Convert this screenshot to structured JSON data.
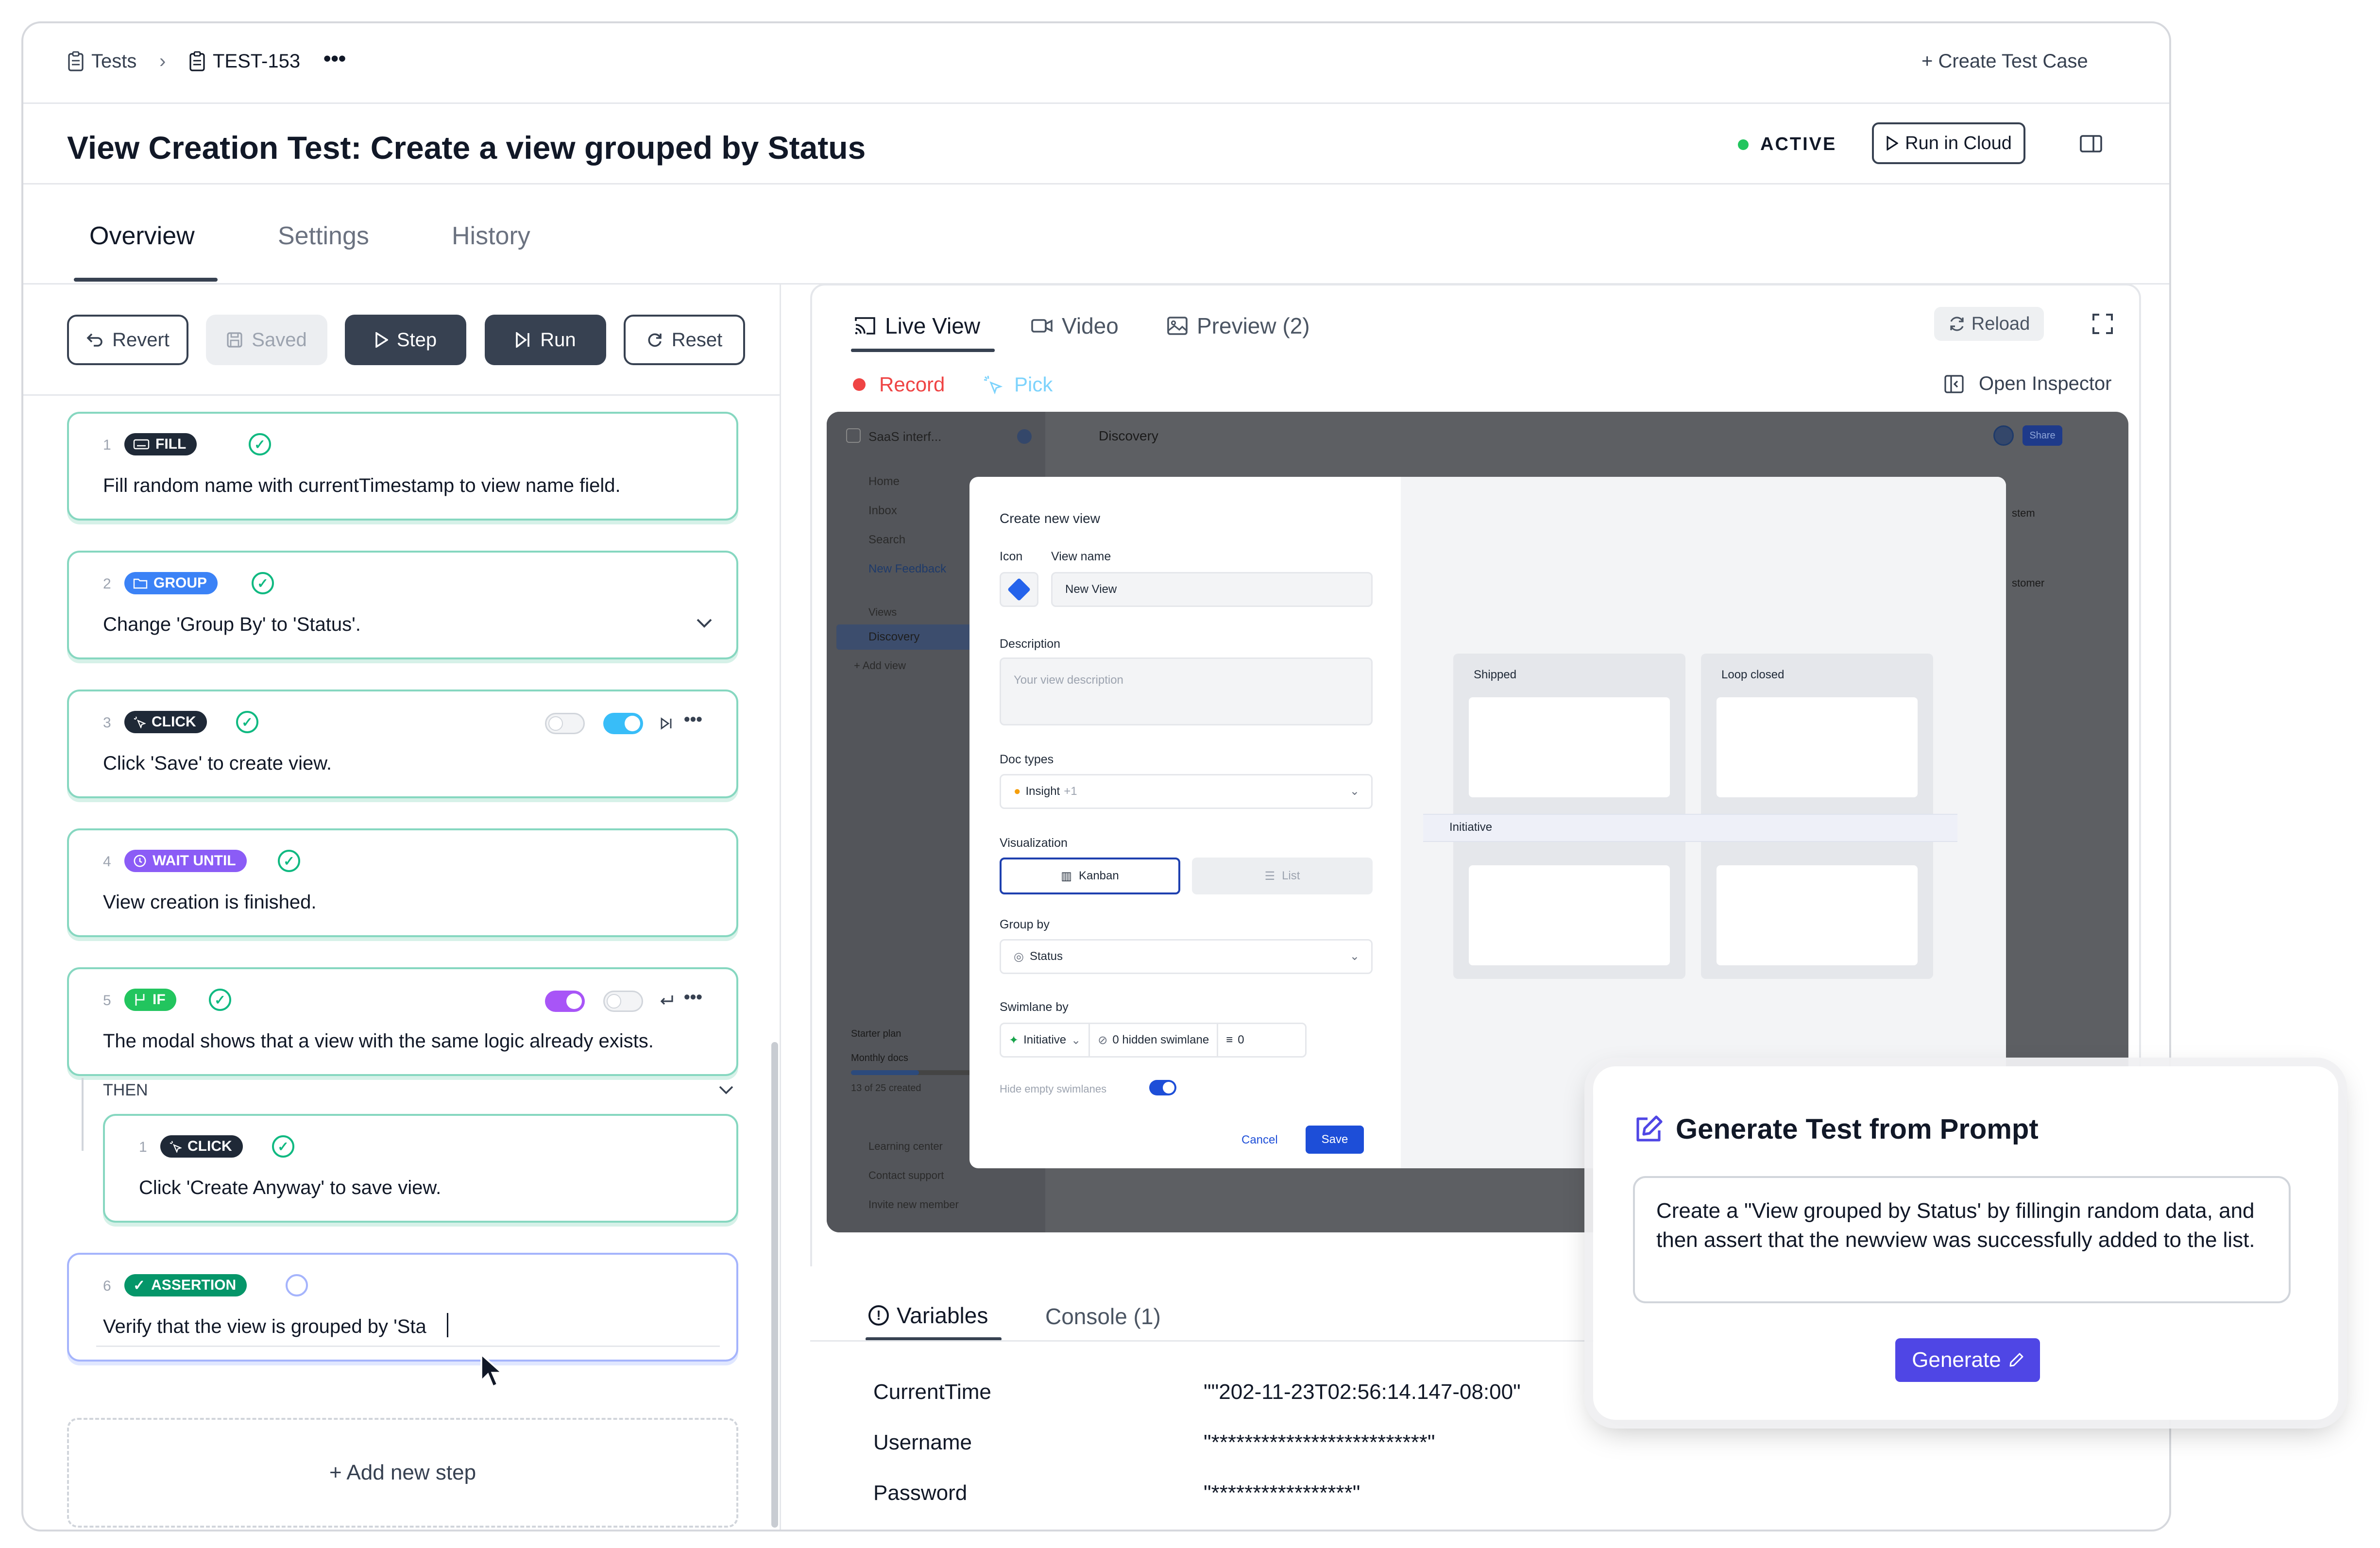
{
  "breadcrumb": {
    "tests": "Tests",
    "test_id": "TEST-153",
    "more": "•••"
  },
  "header": {
    "create": "+ Create Test Case"
  },
  "page": {
    "title": "View Creation Test: Create a view grouped by Status",
    "status": "ACTIVE",
    "run_cloud": "Run in Cloud"
  },
  "tabs": [
    "Overview",
    "Settings",
    "History"
  ],
  "toolbar": {
    "revert": "Revert",
    "saved": "Saved",
    "step": "Step",
    "run": "Run",
    "reset": "Reset"
  },
  "steps": [
    {
      "num": "1",
      "badge": "FILL",
      "text": "Fill random name with currentTimestamp to view name field."
    },
    {
      "num": "2",
      "badge": "GROUP",
      "text": "Change 'Group By' to 'Status'."
    },
    {
      "num": "3",
      "badge": "CLICK",
      "text": "Click 'Save' to create view."
    },
    {
      "num": "4",
      "badge": "WAIT UNTIL",
      "text": "View creation is finished."
    },
    {
      "num": "5",
      "badge": "IF",
      "text": "The modal shows that a view with the same logic already exists."
    },
    {
      "num": "1",
      "badge": "CLICK",
      "text": "Click 'Create Anyway' to save view."
    },
    {
      "num": "6",
      "badge": "ASSERTION",
      "text": "Verify that the view is grouped by 'Sta"
    }
  ],
  "then_label": "THEN",
  "add_step": "+ Add new step",
  "live": {
    "tabs": [
      "Live View",
      "Video",
      "Preview (2)"
    ],
    "reload": "Reload",
    "record": "Record",
    "pick": "Pick",
    "inspector": "Open Inspector"
  },
  "app": {
    "workspace": "SaaS interf...",
    "nav": [
      "Home",
      "Inbox",
      "Search",
      "New Feedback",
      "Views",
      "Discovery",
      "+ Add view"
    ],
    "header": "Discovery",
    "share": "Share",
    "plan": "Starter plan",
    "monthly": "Monthly docs",
    "created": "13 of 25 created",
    "footer": [
      "Learning center",
      "Contact support",
      "Invite new member"
    ],
    "peek": [
      "stem",
      "stomer"
    ]
  },
  "modal": {
    "title": "Create new view",
    "icon_label": "Icon",
    "name_label": "View name",
    "name_value": "New View",
    "desc_label": "Description",
    "desc_placeholder": "Your view description",
    "doc_label": "Doc types",
    "doc_value": "Insight",
    "doc_extra": "+1",
    "vis_label": "Visualization",
    "kanban": "Kanban",
    "list": "List",
    "group_label": "Group by",
    "group_value": "Status",
    "swim_label": "Swimlane by",
    "swim_value": "Initiative",
    "hidden_swim": "0 hidden swimlane",
    "filter_count": "0",
    "hide_empty": "Hide empty swimlanes",
    "cancel": "Cancel",
    "save": "Save",
    "col1": "Shipped",
    "col2": "Loop closed",
    "lane": "Initiative"
  },
  "bottom": {
    "tabs": [
      "Variables",
      "Console (1)"
    ],
    "vars": [
      {
        "name": "CurrentTime",
        "value": "\"\"202-11-23T02:56:14.147-08:00\""
      },
      {
        "name": "Username",
        "value": "\"**************************\""
      },
      {
        "name": "Password",
        "value": "\"*****************\""
      }
    ]
  },
  "prompt": {
    "title": "Generate Test from Prompt",
    "text": "Create a \"View grouped by Status' by fillingin random data, and then assert that the newview was successfully added to the list.",
    "button": "Generate"
  },
  "colors": {
    "fill": "#1f2937",
    "group": "#3b82f6",
    "click": "#1f2937",
    "wait": "#8b5cf6",
    "if": "#22c55e",
    "assertion": "#059669",
    "accent": "#4f46e5",
    "record": "#ef4444",
    "active": "#22c55e"
  }
}
